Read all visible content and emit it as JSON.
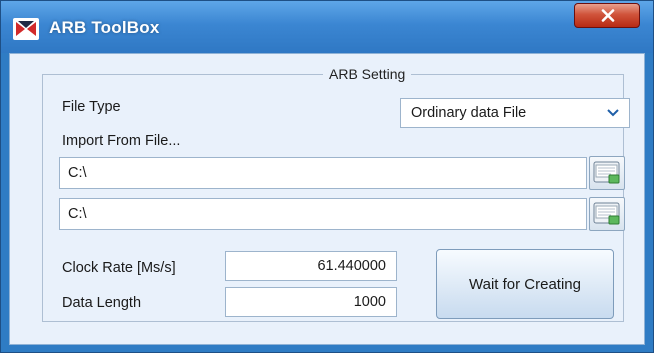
{
  "window": {
    "title": "ARB ToolBox"
  },
  "arb_setting": {
    "group_title": "ARB Setting",
    "file_type_label": "File Type",
    "file_type_value": "Ordinary data File",
    "import_label": "Import From File...",
    "path1": "C:\\",
    "path2": "C:\\",
    "clock_rate_label": "Clock Rate [Ms/s]",
    "clock_rate_value": "61.440000",
    "data_length_label": "Data Length",
    "data_length_value": "1000",
    "action_button": "Wait for Creating"
  },
  "colors": {
    "titlebar": "#3b86d2",
    "client_bg": "#e9f1fb",
    "close_button": "#c8412a"
  },
  "icons": {
    "app": "app-logo-icon",
    "close": "close-icon",
    "dropdown": "chevron-down-icon",
    "browse": "open-file-icon"
  }
}
